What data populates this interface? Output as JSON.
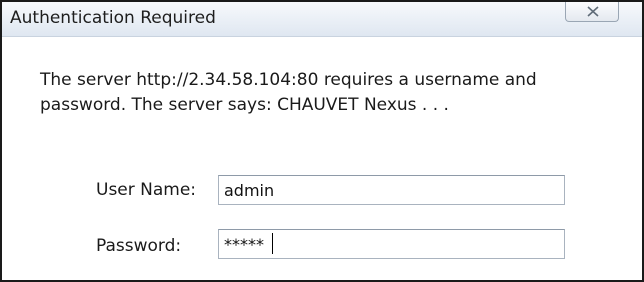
{
  "window": {
    "title": "Authentication Required",
    "close_icon": "close-x-icon"
  },
  "message": "The server http://2.34.58.104:80 requires a username and password. The server says: CHAUVET Nexus . . .",
  "form": {
    "username_label": "User Name:",
    "username_value": "admin",
    "password_label": "Password:",
    "password_value": "*****"
  }
}
